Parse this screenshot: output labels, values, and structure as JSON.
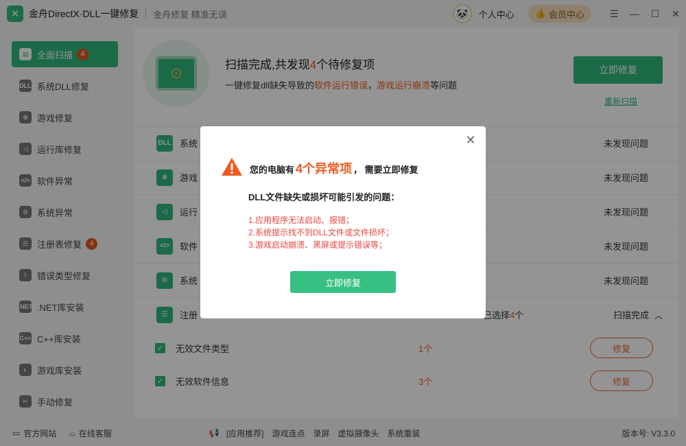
{
  "app": {
    "title": "金舟DirectX·DLL一键修复",
    "slogan": "金舟修复 精准无误",
    "user_center": "个人中心",
    "vip": "会员中心"
  },
  "sidebar": {
    "items": [
      {
        "label": "全面扫描",
        "badge": "4",
        "icon": "scan-icon"
      },
      {
        "label": "系统DLL修复",
        "icon": "dll-icon"
      },
      {
        "label": "游戏修复",
        "icon": "gamepad-icon"
      },
      {
        "label": "运行库修复",
        "icon": "vs-icon"
      },
      {
        "label": "软件异常",
        "icon": "code-icon"
      },
      {
        "label": "系统异常",
        "icon": "gear-icon"
      },
      {
        "label": "注册表修复",
        "badge": "4",
        "icon": "list-icon"
      },
      {
        "label": "错误类型修复",
        "icon": "warning-icon"
      },
      {
        "label": ".NET库安装",
        "icon": "net-icon"
      },
      {
        "label": "C++库安装",
        "icon": "cpp-icon"
      },
      {
        "label": "游戏库安装",
        "icon": "pacman-icon"
      },
      {
        "label": "手动修复",
        "icon": "tools-icon"
      }
    ]
  },
  "hero": {
    "title_pre": "扫描完成,共发现",
    "title_num": "4",
    "title_post": "个待修复项",
    "sub_pre": "一键修复dll缺失导致的",
    "sub_hl1": "软件运行错误",
    "sub_mid": "，",
    "sub_hl2": "游戏运行崩溃",
    "sub_post": "等问题",
    "repair_button": "立即修复",
    "rescan": "重新扫描"
  },
  "rows": [
    {
      "label": "系统",
      "status": "未发现问题",
      "icon": "dll-icon"
    },
    {
      "label": "游戏",
      "status": "未发现问题",
      "icon": "gamepad-icon"
    },
    {
      "label": "运行",
      "status": "未发现问题",
      "icon": "vs-icon"
    },
    {
      "label": "软件",
      "status": "未发现问题",
      "icon": "code-icon"
    },
    {
      "label": "系统",
      "status": "未发现问题",
      "icon": "gear-icon"
    },
    {
      "label": "注册",
      "mid_pre": "已选择",
      "mid_num": "4",
      "mid_post": "个",
      "status": "扫描完成",
      "icon": "list-icon"
    }
  ],
  "subrows": [
    {
      "label": "无效文件类型",
      "count": "1个",
      "fix": "修复"
    },
    {
      "label": "无效软件信息",
      "count": "3个",
      "fix": "修复"
    }
  ],
  "footer": {
    "website": "官方网站",
    "service": "在线客服",
    "links": [
      "[应用推荐]",
      "游戏连点",
      "录屏",
      "虚拟摄像头",
      "系统重装"
    ],
    "version": "版本号: V3.3.0"
  },
  "dialog": {
    "head_pre": "您的电脑有",
    "head_num": "4个异常项",
    "head_post": "，  需要立即修复",
    "subtitle": "DLL文件缺失或损坏可能引发的问题：",
    "issues": [
      "1.应用程序无法启动、报错；",
      "2.系统提示找不到DLL文件或文件损坏；",
      "3.游戏启动崩溃、黑屏或提示错误等；"
    ],
    "button": "立即修复"
  },
  "colors": {
    "accent": "#2fb77d",
    "highlight": "#f05a1e",
    "error": "#e8463b"
  }
}
